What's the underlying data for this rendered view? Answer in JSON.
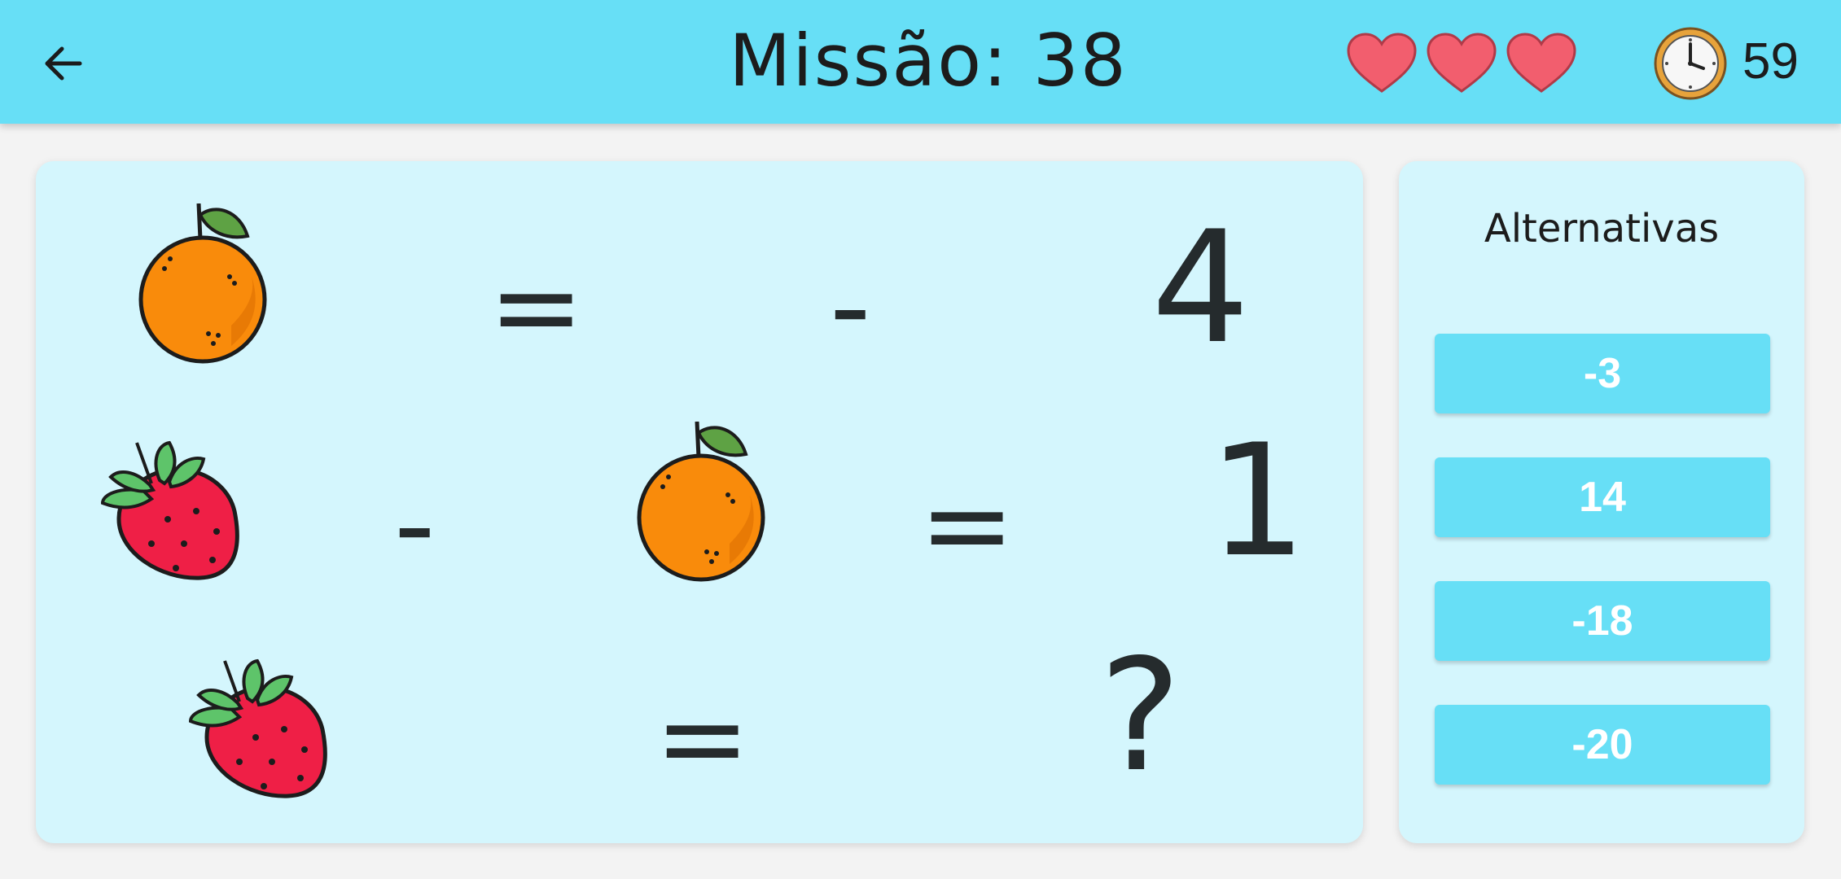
{
  "header": {
    "title": "Missão: 38",
    "lives": 3,
    "timer": "59",
    "icons": {
      "back": "arrow-left-icon",
      "life": "heart-icon",
      "clock": "clock-icon"
    },
    "bar_color": "#67dff6"
  },
  "puzzle": {
    "rows": [
      {
        "left": [
          "orange"
        ],
        "equals": "=",
        "result": "- 4"
      },
      {
        "left": [
          "strawberry",
          "-",
          "orange"
        ],
        "equals": "=",
        "result": "1"
      },
      {
        "left": [
          "strawberry"
        ],
        "equals": "=",
        "result": "?"
      }
    ],
    "minus": "-",
    "equals": "=",
    "row1_result": "4",
    "row2_result": "1",
    "row3_result": "?"
  },
  "alternatives": {
    "title": "Alternativas",
    "options": [
      "-3",
      "14",
      "-18",
      "-20"
    ]
  }
}
